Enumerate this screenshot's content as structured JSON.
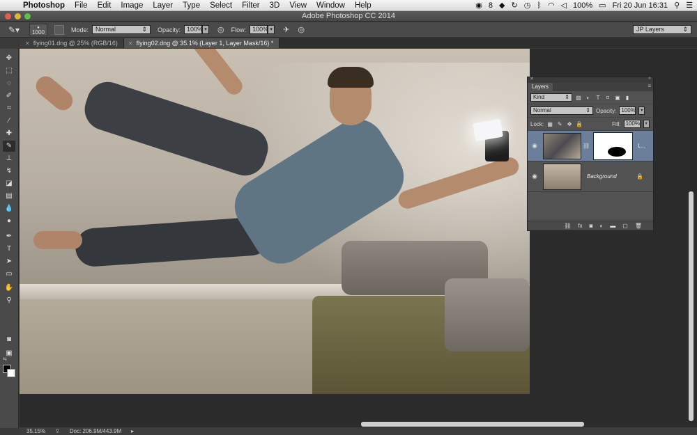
{
  "menubar": {
    "apple_icon": "apple-icon",
    "app_name": "Photoshop",
    "items": [
      "File",
      "Edit",
      "Image",
      "Layer",
      "Type",
      "Select",
      "Filter",
      "3D",
      "View",
      "Window",
      "Help"
    ],
    "tray": {
      "notification_count": "8",
      "battery": "100%",
      "datetime": "Fri 20 Jun  16:31"
    }
  },
  "window": {
    "title": "Adobe Photoshop CC 2014"
  },
  "options": {
    "brush_size": "1000",
    "mode_label": "Mode:",
    "mode_value": "Normal",
    "opacity_label": "Opacity:",
    "opacity_value": "100%",
    "flow_label": "Flow:",
    "flow_value": "100%",
    "workspace": "JP Layers"
  },
  "tabs": [
    {
      "label": "flying01.dng @ 25% (RGB/16)",
      "active": false
    },
    {
      "label": "flying02.dng @ 35.1% (Layer 1, Layer Mask/16) *",
      "active": true
    }
  ],
  "status": {
    "zoom": "35.15%",
    "doc": "Doc: 206.9M/443.9M"
  },
  "layers_panel": {
    "tab": "Layers",
    "kind_label": "Kind",
    "blend_mode": "Normal",
    "opacity_label": "Opacity:",
    "opacity_value": "100%",
    "lock_label": "Lock:",
    "fill_label": "Fill:",
    "fill_value": "100%",
    "layers": [
      {
        "name": "L...",
        "selected": true
      },
      {
        "name": "Background",
        "selected": false
      }
    ]
  },
  "colors": {
    "accent": "#6b7f9b",
    "fg_swatch": "#000000",
    "bg_swatch": "#ffffff"
  }
}
